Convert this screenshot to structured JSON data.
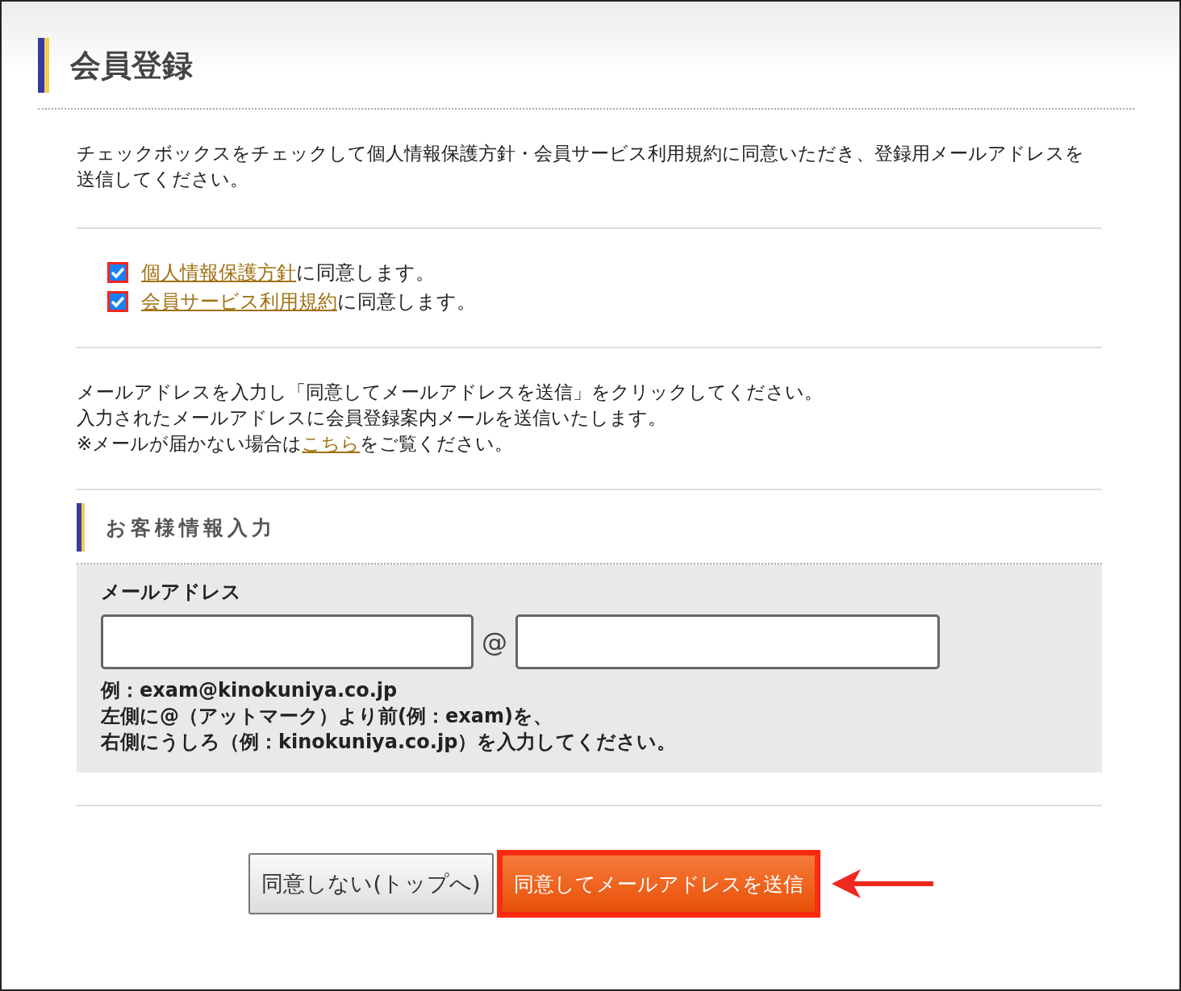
{
  "title": "会員登録",
  "intro": "チェックボックスをチェックして個人情報保護方針・会員サービス利用規約に同意いただき、登録用メールアドレスを送信してください。",
  "agreements": [
    {
      "link": "個人情報保護方針",
      "suffix": "に同意します。",
      "checked": true
    },
    {
      "link": "会員サービス利用規約",
      "suffix": "に同意します。",
      "checked": true
    }
  ],
  "instructions": {
    "lines": [
      "メールアドレスを入力し「同意してメールアドレスを送信」をクリックしてください。",
      "入力されたメールアドレスに会員登録案内メールを送信いたします。"
    ],
    "note_prefix": "※メールが届かない場合は",
    "note_link": "こちら",
    "note_suffix": "をご覧ください。"
  },
  "section_title": "お客様情報入力",
  "email": {
    "label": "メールアドレス",
    "separator": "@",
    "hints": [
      "例：exam@kinokuniya.co.jp",
      "左側に@（アットマーク）より前(例：exam)を、",
      "右側にうしろ（例：kinokuniya.co.jp）を入力してください。"
    ]
  },
  "buttons": {
    "decline": "同意しない(トップへ)",
    "submit": "同意してメールアドレスを送信"
  }
}
